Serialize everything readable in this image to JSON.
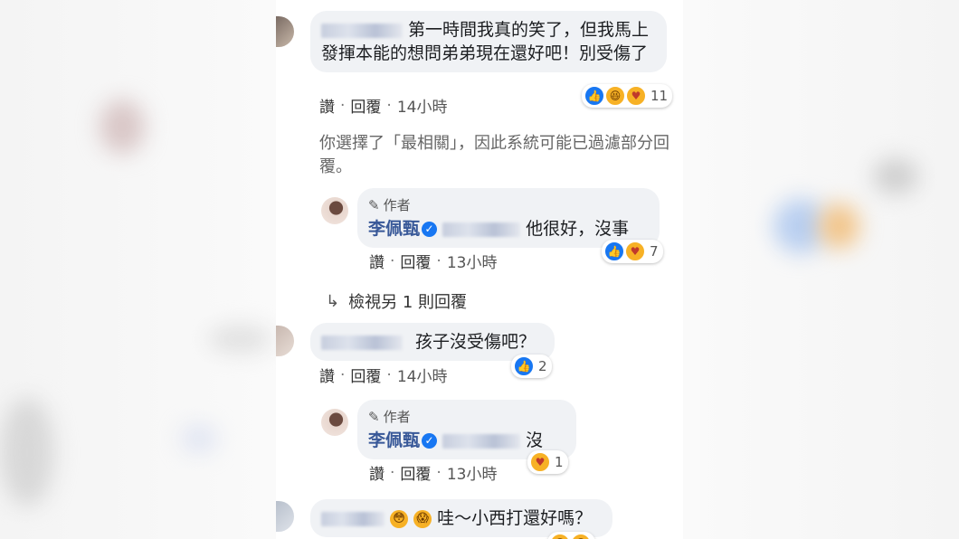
{
  "comments": [
    {
      "text": "第一時間我真的笑了，但我馬上發揮本能的想問弟弟現在還好吧！別受傷了",
      "actions": {
        "like": "讚",
        "sep": "·",
        "reply": "回覆",
        "time": "14小時"
      },
      "reaction_count": "11",
      "reaction_icons": [
        "like-icon",
        "haha-icon",
        "care-icon"
      ]
    },
    {
      "text": "孩子沒受傷吧？",
      "actions": {
        "like": "讚",
        "sep": "·",
        "reply": "回覆",
        "time": "14小時"
      },
      "reaction_count": "2",
      "reaction_icons": [
        "like-icon"
      ]
    },
    {
      "text": "哇～小西打還好嗎？",
      "reaction_icons": [
        "wow-icon",
        "wow-icon"
      ]
    }
  ],
  "notice": "你選擇了「最相關」，因此系統可能已過濾部分回覆。",
  "replies": [
    {
      "author_tag": "作者",
      "author_name": "李佩甄",
      "text": "他很好，沒事",
      "actions": {
        "like": "讚",
        "sep": "·",
        "reply": "回覆",
        "time": "13小時"
      },
      "reaction_count": "7",
      "reaction_icons": [
        "like-icon",
        "care-icon"
      ]
    },
    {
      "author_tag": "作者",
      "author_name": "李佩甄",
      "text": "沒",
      "actions": {
        "like": "讚",
        "sep": "·",
        "reply": "回覆",
        "time": "13小時"
      },
      "reaction_count": "1",
      "reaction_icons": [
        "care-icon"
      ]
    }
  ],
  "view_more": {
    "label": "檢視另 1 則回覆",
    "icon": "reply-arrow-icon"
  },
  "colors": {
    "bubble": "#f0f2f5",
    "like_blue": "#1877f2",
    "author_blue": "#385898"
  }
}
